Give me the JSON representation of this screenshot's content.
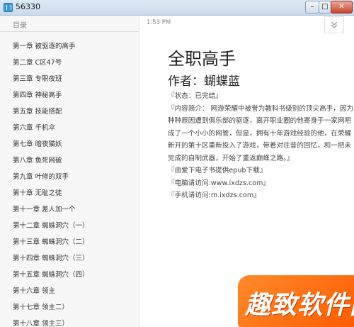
{
  "window": {
    "title": "56330",
    "minimize_glyph": "–",
    "maximize_glyph": "□",
    "close_glyph": "✕"
  },
  "sidebar": {
    "header": "目录",
    "items": [
      {
        "label": "第一章 被驱逐的高手"
      },
      {
        "label": "第二章 C区47号"
      },
      {
        "label": "第三章 专职夜班"
      },
      {
        "label": "第四章 神秘高手"
      },
      {
        "label": "第五章 技能搭配"
      },
      {
        "label": "第六章 千机伞"
      },
      {
        "label": "第七章 暗夜猫妖"
      },
      {
        "label": "第八章 鱼死网破"
      },
      {
        "label": "第九章 叶修的双手"
      },
      {
        "label": "第十章 无耻之徒"
      },
      {
        "label": "第十一章 差人加一个"
      },
      {
        "label": "第十二章 蜘蛛洞穴（一）"
      },
      {
        "label": "第十三章 蜘蛛洞穴（二）"
      },
      {
        "label": "第十四章 蜘蛛洞穴（三）"
      },
      {
        "label": "第十五章 蜘蛛洞穴（四）"
      },
      {
        "label": "第十六章 领主"
      },
      {
        "label": "第十七章 领主二）"
      },
      {
        "label": "第十八章 领主三）"
      }
    ]
  },
  "main": {
    "time": "1:53 PM",
    "collapse_icon": "double-chevron-down-icon",
    "book_title": "全职高手",
    "author": "作者：蝴蝶蓝",
    "status": "『状态：已完结』",
    "intro": "『内容简介： 网游荣耀中被誉为教科书级别的顶尖高手，因为种种原因遭到俱乐部的驱逐，离开职业圈的他寄身于一家网吧成了一个小小的网管，但是，拥有十年游戏经验的他，在荣耀新开的第十区重新投入了游戏，带着对往昔的回忆，和一把未完成的自制武器，开始了重返巅峰之路。』",
    "source": "『由爱下电子书提供epub下载』",
    "pc_url": "『电脑请访问:www.ixdzs.com』",
    "mobile_url": "『手机请访问:m.ixdzs.com』"
  },
  "watermark": {
    "text": "趣致软件园"
  },
  "colors": {
    "sidebar_bg": "#f7f7f7",
    "watermark_orange": "#ff6a10",
    "titlebar_close_red": "#c7432e"
  }
}
